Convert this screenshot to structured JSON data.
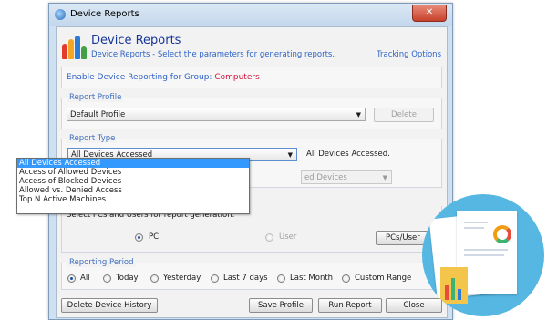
{
  "window": {
    "title": "Device Reports",
    "close_glyph": "✕",
    "app_icon": "shield-globe-icon"
  },
  "header": {
    "title": "Device Reports",
    "subtitle": "Device Reports - Select the parameters for generating reports.",
    "tracking_link": "Tracking Options"
  },
  "group_reporting": {
    "label": "Enable Device Reporting for Group:",
    "group_name": "Computers"
  },
  "report_profile": {
    "legend": "Report Profile",
    "selected": "Default Profile",
    "delete_label": "Delete"
  },
  "report_type": {
    "legend": "Report Type",
    "selected": "All Devices Accessed",
    "description": "All Devices Accessed.",
    "options": [
      "All Devices Accessed",
      "Access of Allowed Devices",
      "Access of Blocked Devices",
      "Allowed vs. Denied Access",
      "Top N Active Machines"
    ],
    "secondary_select": "ed Devices"
  },
  "selection": {
    "prompt": "Select PCs and Users for report generation.",
    "pc_label": "PC",
    "user_label": "User",
    "pcs_button": "PCs/User"
  },
  "reporting_period": {
    "legend": "Reporting Period",
    "options": [
      "All",
      "Today",
      "Yesterday",
      "Last 7 days",
      "Last Month",
      "Custom Range"
    ],
    "selected": "All"
  },
  "footer": {
    "delete_history": "Delete Device History",
    "save_profile": "Save Profile",
    "run_report": "Run Report",
    "close": "Close"
  },
  "colors": {
    "accent": "#2f63c6",
    "title": "#17359b",
    "group_name": "#d0163d",
    "selection": "#3399ff"
  }
}
